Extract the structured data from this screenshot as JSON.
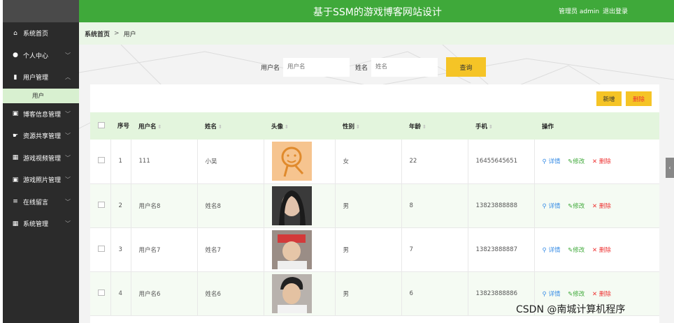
{
  "header": {
    "title": "基于SSM的游戏博客网站设计",
    "user_label": "管理员 admin",
    "logout_label": "退出登录"
  },
  "sidebar": {
    "items": [
      {
        "label": "系统首页",
        "icon": "home-icon"
      },
      {
        "label": "个人中心",
        "icon": "user-icon"
      },
      {
        "label": "用户管理",
        "icon": "bar-chart-icon"
      },
      {
        "label": "博客信息管理",
        "icon": "book-icon"
      },
      {
        "label": "资源共享管理",
        "icon": "thumb-icon"
      },
      {
        "label": "游戏视频管理",
        "icon": "grid-icon"
      },
      {
        "label": "游戏照片管理",
        "icon": "book-icon"
      },
      {
        "label": "在线留言",
        "icon": "list-icon"
      },
      {
        "label": "系统管理",
        "icon": "grid-icon"
      }
    ],
    "subitem": "用户"
  },
  "breadcrumb": {
    "home": "系统首页",
    "separator": ">",
    "current": "用户"
  },
  "search": {
    "username_label": "用户名",
    "username_placeholder": "用户名",
    "name_label": "姓名",
    "name_placeholder": "姓名",
    "query_button": "查询"
  },
  "actions": {
    "add": "新增",
    "delete": "删除"
  },
  "table": {
    "headers": {
      "index": "序号",
      "username": "用户名",
      "name": "姓名",
      "avatar": "头像",
      "gender": "性别",
      "age": "年龄",
      "phone": "手机",
      "ops": "操作"
    },
    "op_labels": {
      "detail": "详情",
      "edit": "修改",
      "delete": "删除"
    },
    "rows": [
      {
        "index": "1",
        "username": "111",
        "name": "小吴",
        "gender": "女",
        "age": "22",
        "phone": "16455645651",
        "avatar": "cartoon-face"
      },
      {
        "index": "2",
        "username": "用户名8",
        "name": "姓名8",
        "gender": "男",
        "age": "8",
        "phone": "13823888888",
        "avatar": "photo"
      },
      {
        "index": "3",
        "username": "用户名7",
        "name": "姓名7",
        "gender": "男",
        "age": "7",
        "phone": "13823888887",
        "avatar": "photo"
      },
      {
        "index": "4",
        "username": "用户名6",
        "name": "姓名6",
        "gender": "男",
        "age": "6",
        "phone": "13823888886",
        "avatar": "photo"
      }
    ]
  },
  "watermark": "CSDN @南城计算机程序",
  "colors": {
    "header_green": "#3fa93a",
    "sidebar_dark": "#2b2b2b",
    "button_yellow": "#f5c426",
    "delete_red": "#e33333",
    "detail_blue": "#3a8ee6"
  }
}
